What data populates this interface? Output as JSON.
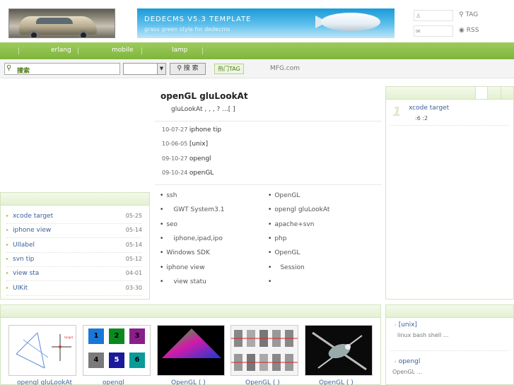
{
  "header": {
    "banner_title": "DEDECMS V5.3 TEMPLATE",
    "banner_subtitle": "grass green style for dedecms",
    "top_links": [
      {
        "icon": "user-icon",
        "glyph": "♙",
        "label": "TAG",
        "label_icon": "search-icon",
        "label_glyph": "⚲"
      },
      {
        "icon": "mail-icon",
        "glyph": "✉",
        "label": "RSS",
        "label_icon": "rss-icon",
        "label_glyph": "◉"
      }
    ]
  },
  "nav": {
    "items": [
      "erlang",
      "mobile",
      "lamp"
    ]
  },
  "search": {
    "placeholder": "搜索",
    "button_label": "搜 索",
    "hot_tag_label": "热门TAG",
    "extra_link": "MFG.com"
  },
  "article": {
    "title": "openGL   gluLookAt",
    "summary": "gluLookAt         ,       ,          ,        ?       ...[   ]",
    "recent": [
      {
        "date": "10-07-27",
        "title": "iphone tip"
      },
      {
        "date": "10-06-05",
        "title": "[unix]"
      },
      {
        "date": "09-10-27",
        "title": "opengl"
      },
      {
        "date": "09-10-24",
        "title": "openGL"
      }
    ],
    "bullets_left": [
      "ssh",
      "GWT System3.1",
      "seo",
      "iphone,ipad,ipo",
      "Windows SDK",
      "iphone   view",
      "view   statu"
    ],
    "bullets_right": [
      "OpenGL",
      "opengl gluLookAt",
      "apache+svn",
      "php",
      "OpenGL",
      "Session",
      ""
    ]
  },
  "left_list": [
    {
      "title": "xcode   target",
      "date": "05-25"
    },
    {
      "title": "iphone   view",
      "date": "05-14"
    },
    {
      "title": "UIlabel",
      "date": "05-14"
    },
    {
      "title": "svn         tip",
      "date": "05-12"
    },
    {
      "title": "     view   sta",
      "date": "04-01"
    },
    {
      "title": "UIKit",
      "date": "03-30"
    }
  ],
  "right_top": {
    "rank": "1",
    "title": "xcode   target",
    "stats": ":6     :2"
  },
  "right_bottom": {
    "items": [
      {
        "title": "[unix]",
        "desc": "linux             bash shell          ..."
      },
      {
        "title": "opengl",
        "desc": "OpenGL                          ..."
      }
    ]
  },
  "thumbnails": [
    {
      "caption": "opengl gluLookAt"
    },
    {
      "caption": "opengl"
    },
    {
      "caption": "OpenGL     (   )"
    },
    {
      "caption": "OpenGL     (   )"
    },
    {
      "caption": "OpenGL     (   )"
    }
  ],
  "thumb_grid_numbers": [
    "1",
    "2",
    "3",
    "4",
    "5",
    "6"
  ],
  "colors": {
    "accent_green": "#7fb53c",
    "link_blue": "#3a5f9a"
  }
}
